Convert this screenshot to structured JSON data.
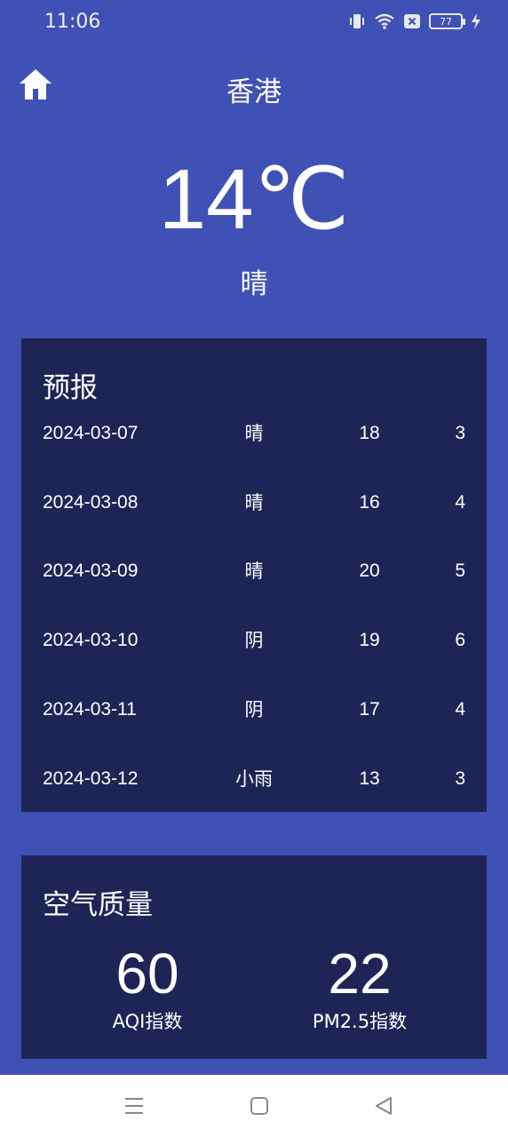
{
  "status": {
    "time": "11:06",
    "battery": "77"
  },
  "header": {
    "home_icon": "home-icon",
    "city": "香港"
  },
  "current": {
    "temperature": "14℃",
    "weather": "晴"
  },
  "forecast": {
    "title": "预报",
    "rows": [
      {
        "date": "2024-03-07",
        "weather": "晴",
        "max": "18",
        "min": "3"
      },
      {
        "date": "2024-03-08",
        "weather": "晴",
        "max": "16",
        "min": "4"
      },
      {
        "date": "2024-03-09",
        "weather": "晴",
        "max": "20",
        "min": "5"
      },
      {
        "date": "2024-03-10",
        "weather": "阴",
        "max": "19",
        "min": "6"
      },
      {
        "date": "2024-03-11",
        "weather": "阴",
        "max": "17",
        "min": "4"
      },
      {
        "date": "2024-03-12",
        "weather": "小雨",
        "max": "13",
        "min": "3"
      }
    ]
  },
  "air_quality": {
    "title": "空气质量",
    "aqi_value": "60",
    "aqi_label": "AQI指数",
    "pm25_value": "22",
    "pm25_label": "PM2.5指数"
  },
  "colors": {
    "background": "#3f51b5",
    "card": "#1e2556",
    "text": "#ffffff",
    "nav_bar": "#ffffff"
  }
}
